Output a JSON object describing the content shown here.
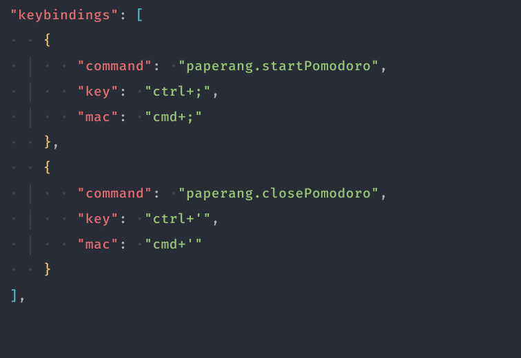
{
  "code": {
    "section_key": "\"keybindings\"",
    "open_bracket": "[",
    "close_bracket": "]",
    "open_brace": "{",
    "close_brace": "}",
    "bindings": [
      {
        "k_command": "\"command\"",
        "v_command": "\"paperang.startPomodoro\"",
        "k_key": "\"key\"",
        "v_key": "\"ctrl+;\"",
        "k_mac": "\"mac\"",
        "v_mac": "\"cmd+;\""
      },
      {
        "k_command": "\"command\"",
        "v_command": "\"paperang.closePomodoro\"",
        "k_key": "\"key\"",
        "v_key": "\"ctrl+'\"",
        "k_mac": "\"mac\"",
        "v_mac": "\"cmd+'\""
      }
    ]
  }
}
